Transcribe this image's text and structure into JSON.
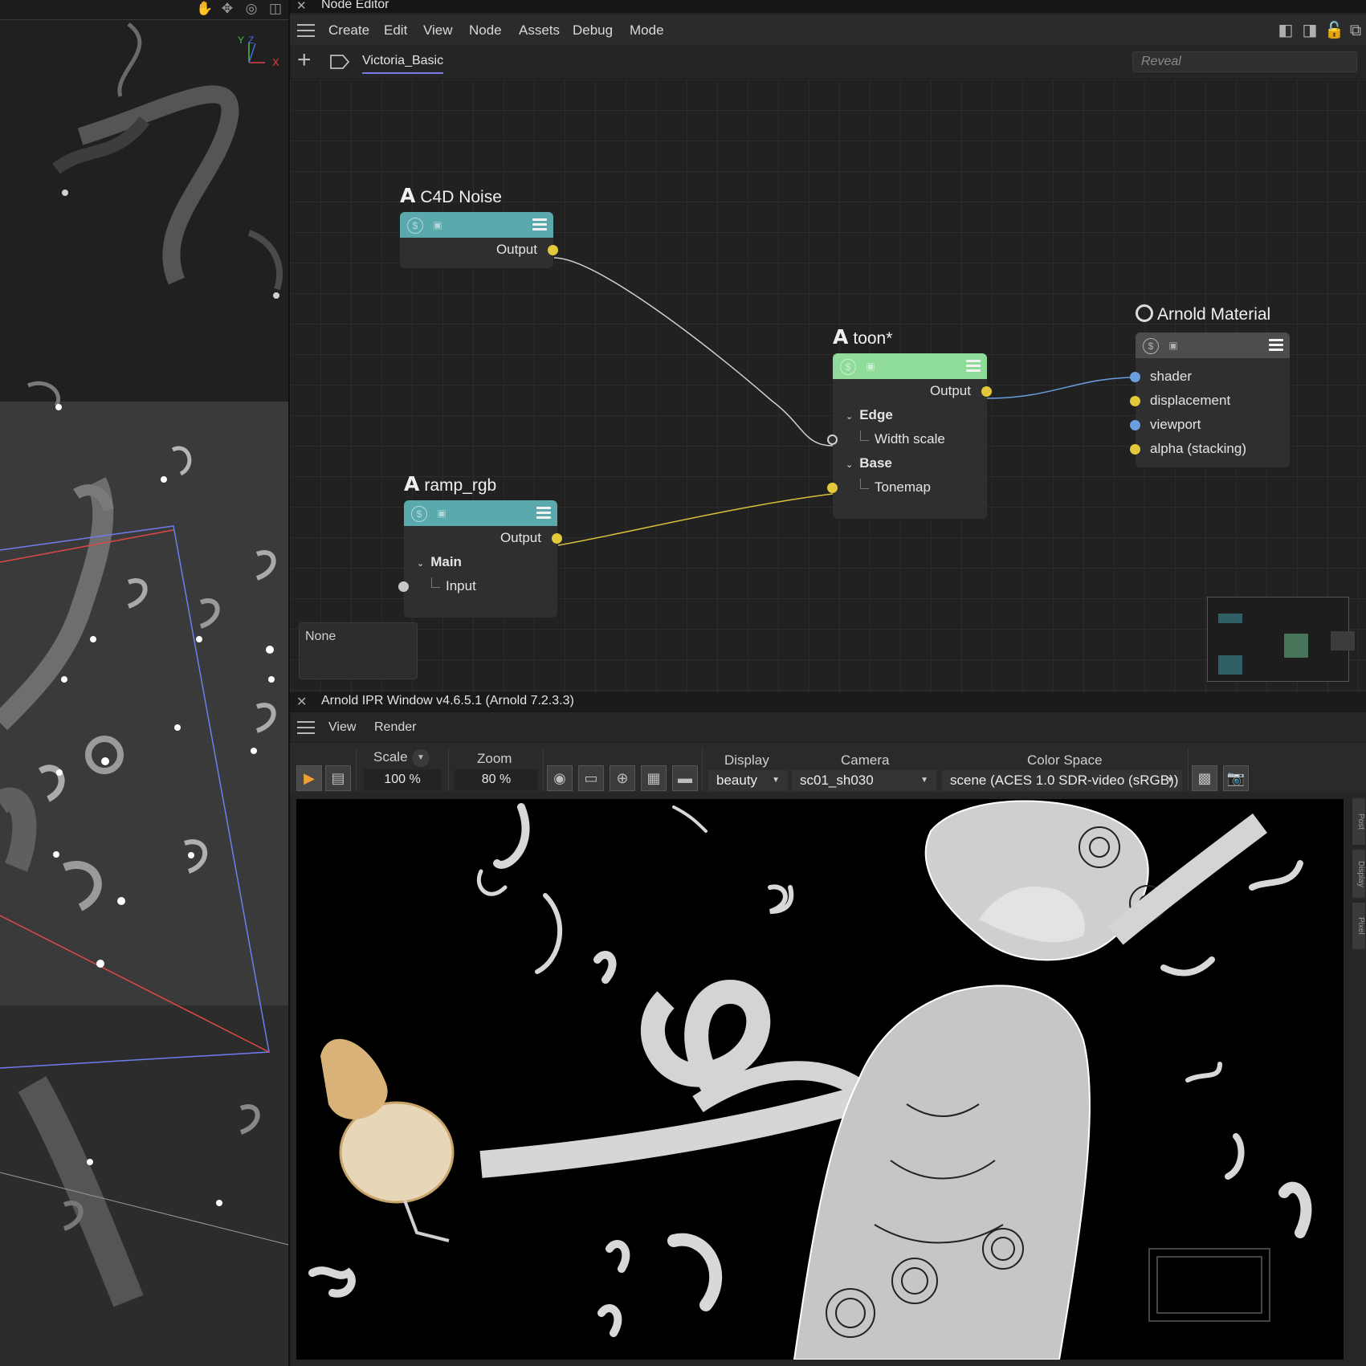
{
  "viewport": {
    "axis_labels": {
      "y": "Y",
      "z": "Z",
      "x": "X"
    }
  },
  "node_editor": {
    "title": "Node Editor",
    "menu": [
      "Create",
      "Edit",
      "View",
      "Node",
      "Assets",
      "Debug",
      "Mode"
    ],
    "tab": "Victoria_Basic",
    "search_placeholder": "Reveal",
    "nodes": {
      "c4d_noise": {
        "glyph": "A",
        "title": "C4D Noise",
        "output": "Output"
      },
      "ramp_rgb": {
        "glyph": "A",
        "title": "ramp_rgb",
        "output": "Output",
        "group": "Main",
        "input": "Input"
      },
      "toon": {
        "glyph": "A",
        "title": "toon*",
        "output": "Output",
        "group1": "Edge",
        "param1": "Width scale",
        "group2": "Base",
        "param2": "Tonemap"
      },
      "arnold_material": {
        "title": "Arnold Material",
        "ports": [
          "shader",
          "displacement",
          "viewport",
          "alpha (stacking)"
        ]
      }
    },
    "none_label": "None",
    "colors": {
      "c4d_noise_header": "#5aa9ad",
      "ramp_rgb_header": "#5aa9ad",
      "toon_header": "#8fdc9a",
      "arnold_header": "#4d4d4d",
      "wire_float": "#cfcfcf",
      "wire_color": "#d9c23a",
      "wire_shader": "#6a9ee0"
    }
  },
  "ipr": {
    "title": "Arnold IPR Window v4.6.5.1 (Arnold 7.2.3.3)",
    "menu": [
      "View",
      "Render"
    ],
    "scale_label": "Scale",
    "scale_value": "100 %",
    "zoom_label": "Zoom",
    "zoom_value": "80 %",
    "display_label": "Display",
    "display_value": "beauty",
    "camera_label": "Camera",
    "camera_value": "sc01_sh030",
    "colorspace_label": "Color Space",
    "colorspace_value": "scene (ACES 1.0 SDR-video (sRGB))",
    "side_tabs": [
      "Post",
      "Display",
      "Pixel"
    ]
  }
}
